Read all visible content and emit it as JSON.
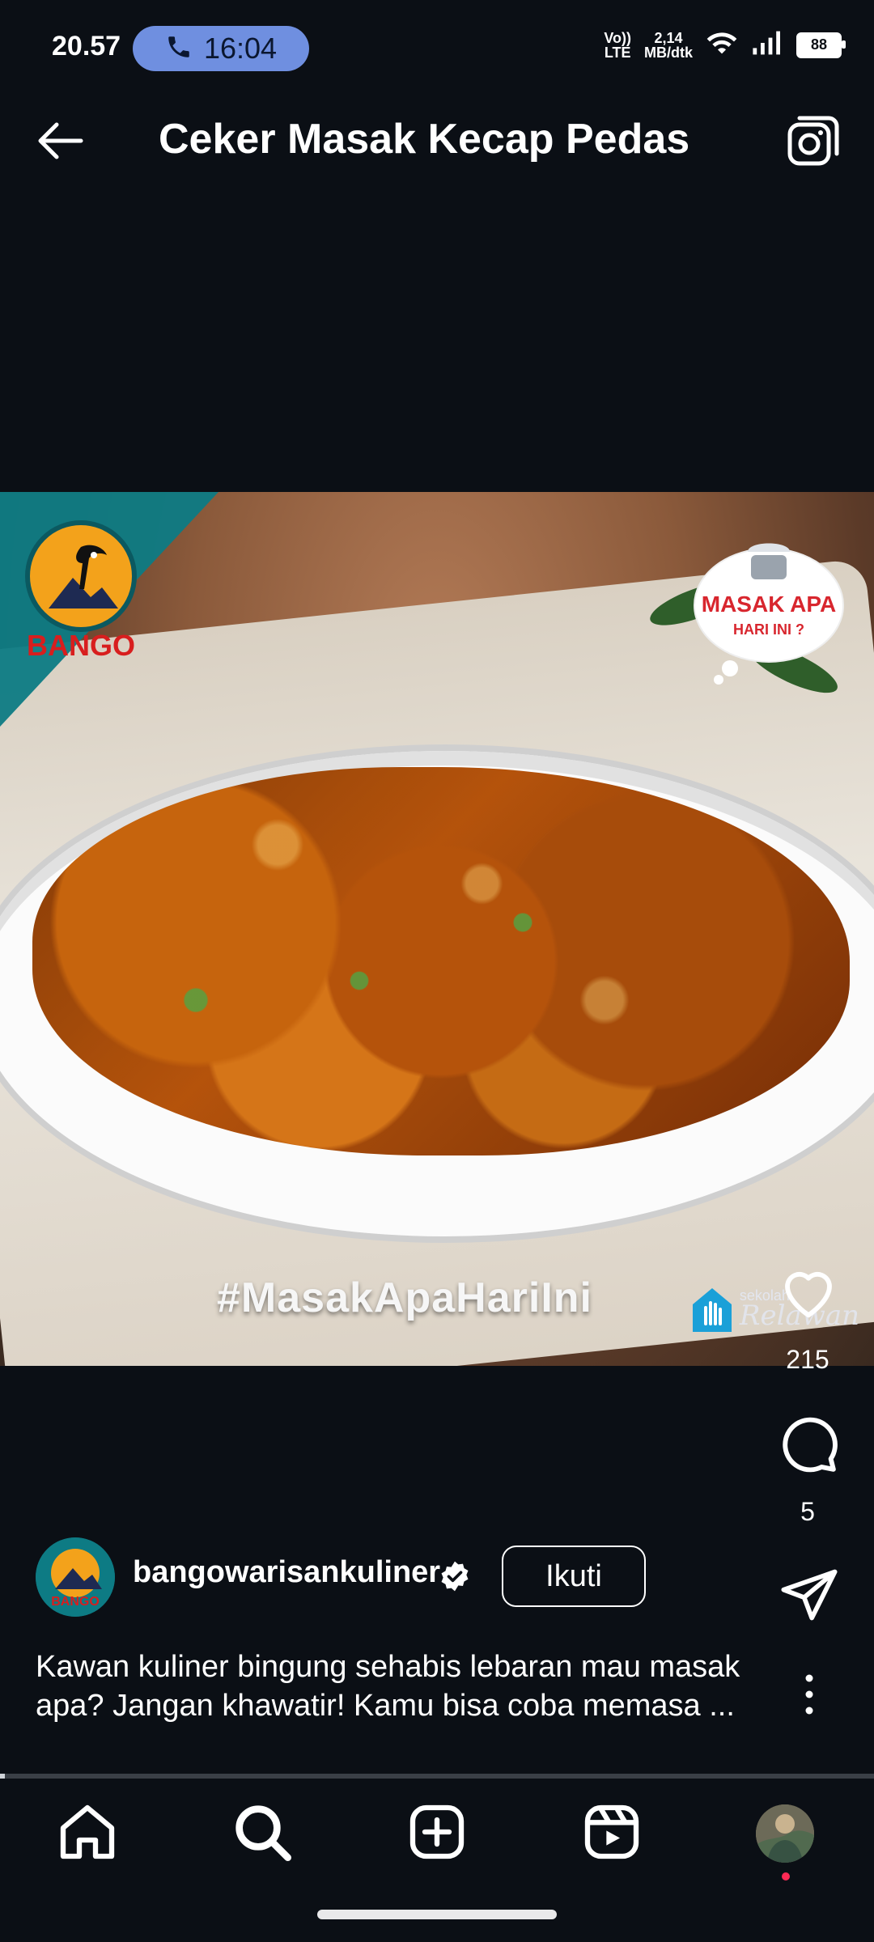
{
  "status_bar": {
    "time": "20.57",
    "call_duration": "16:04",
    "volte": "Vo))\nLTE",
    "network_speed_value": "2,14",
    "network_speed_unit": "MB/dtk",
    "battery_level": "88",
    "icons": [
      "phone-icon",
      "wifi-icon",
      "signal-icon",
      "battery-icon"
    ]
  },
  "header": {
    "title": "Ceker Masak Kecap Pedas",
    "icons": [
      "back-arrow-icon",
      "camera-icon"
    ]
  },
  "video": {
    "hashtag": "#MasakApaHariIni",
    "logos": {
      "left": "BANGO",
      "right_line1": "MASAK APA",
      "right_line2": "HARI INI ?",
      "watermark_small": "sekolah",
      "watermark_main": "Relawan"
    }
  },
  "actions": {
    "like_count": "215",
    "comment_count": "5",
    "icons": [
      "heart-icon",
      "comment-icon",
      "send-icon",
      "more-vertical-icon"
    ]
  },
  "author": {
    "username": "bangowarisankuliner",
    "follow_label": "Ikuti",
    "avatar_text": "BANGO",
    "verified": true
  },
  "caption": {
    "text": "Kawan kuliner bingung sehabis lebaran mau masak apa? Jangan khawatir! Kamu bisa coba memasa ..."
  },
  "playback": {
    "progress": 0.006
  },
  "bottom_nav": {
    "items": [
      "home-icon",
      "search-icon",
      "add-post-icon",
      "reels-icon",
      "profile-avatar"
    ]
  },
  "colors": {
    "background": "#0b0f15",
    "call_pill": "#6f8fe0",
    "brand_teal": "#0d7b84",
    "notification_dot": "#ff2a55"
  }
}
